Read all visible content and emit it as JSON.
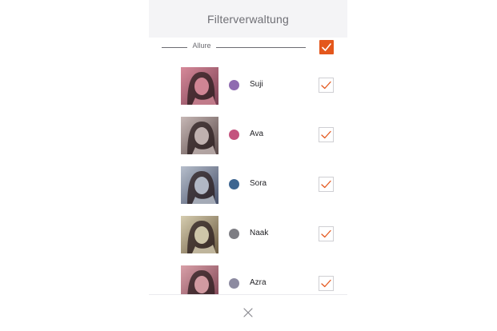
{
  "header": {
    "title": "Filterverwaltung"
  },
  "group": {
    "label": "Allure",
    "checked": true
  },
  "filters": [
    {
      "name": "Suji",
      "color": "#8f6bb0",
      "checked": true,
      "tint": [
        "#d78a9a",
        "#7a3f52"
      ]
    },
    {
      "name": "Ava",
      "color": "#c4527e",
      "checked": true,
      "tint": [
        "#c7b8b6",
        "#5a4948"
      ]
    },
    {
      "name": "Sora",
      "color": "#3d6590",
      "checked": true,
      "tint": [
        "#b7bfcc",
        "#47506a"
      ]
    },
    {
      "name": "Naak",
      "color": "#7d7d83",
      "checked": true,
      "tint": [
        "#d6cdb0",
        "#6b5a40"
      ]
    },
    {
      "name": "Azra",
      "color": "#8c8aa0",
      "checked": true,
      "tint": [
        "#d9a0a8",
        "#7a4050"
      ]
    }
  ],
  "colors": {
    "accent": "#e4571c",
    "header_bg": "#f4f4f6"
  },
  "icons": {
    "close": "close-icon",
    "check": "check-icon"
  }
}
